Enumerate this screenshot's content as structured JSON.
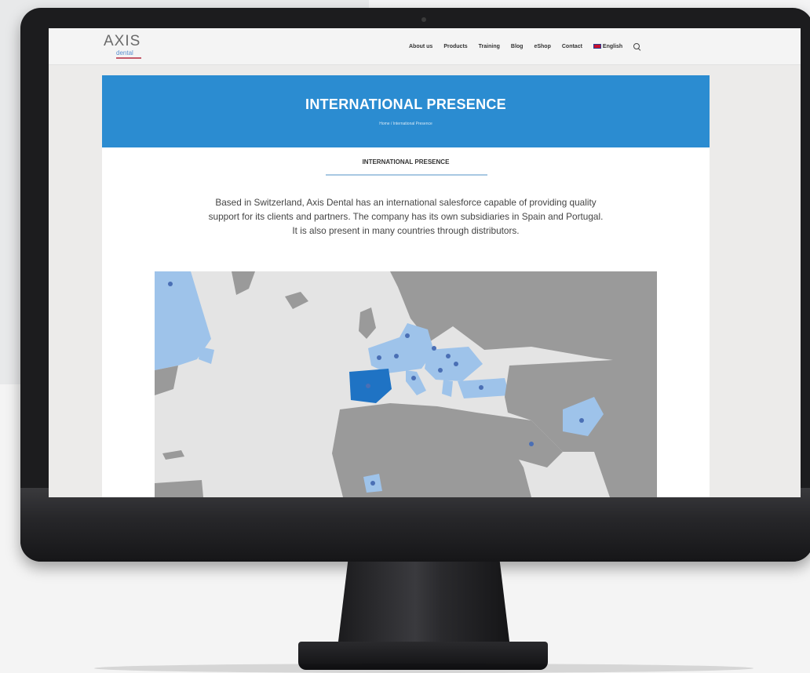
{
  "window": {
    "logo": {
      "main": "AXIS",
      "sub": "dental"
    },
    "nav": {
      "items": [
        "About us",
        "Products",
        "Training",
        "Blog",
        "eShop",
        "Contact"
      ],
      "language": "English"
    }
  },
  "page": {
    "hero_title": "INTERNATIONAL PRESENCE",
    "breadcrumb": "Home / International Presence",
    "section_title": "INTERNATIONAL PRESENCE",
    "intro_line1": "Based in Switzerland, Axis Dental has an international salesforce capable of providing quality",
    "intro_line2": "support for its clients and partners. The company has its own subsidiaries in Spain and Portugal.",
    "intro_line3": "It is also present in many countries through distributors."
  },
  "map": {
    "colors": {
      "ocean": "#e4e4e4",
      "land": "#9a9a9a",
      "distributor": "#9ec3ea",
      "subsidiary": "#1f73c4",
      "marker": "#4a6fb5"
    }
  },
  "colors": {
    "accent": "#2b8cd1",
    "text": "#444444"
  }
}
